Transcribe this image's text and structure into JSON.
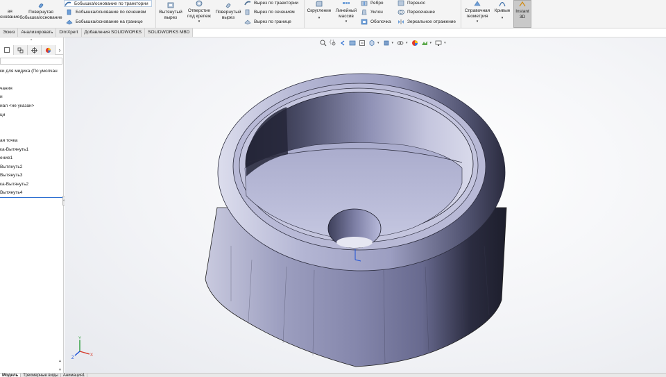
{
  "ribbon": {
    "revolve_boss_label_partial": "ая\nснование",
    "revolve_boss_label": "Повернутая\nбобышка/основание",
    "swept_boss_label": "Бобышка/основание по траектории",
    "lofted_boss_label": "Бобышка/основание по сечениям",
    "boundary_boss_label": "Бобышка/основание на границе",
    "extruded_cut_label": "Вытянутый\nвырез",
    "hole_wizard_label": "Отверстие\nпод крепеж",
    "revolved_cut_label": "Повернутый\nвырез",
    "swept_cut_label": "Вырез по траектории",
    "lofted_cut_label": "Вырез по сечениям",
    "boundary_cut_label": "Вырез по границе",
    "fillet_label": "Скругление",
    "linear_pattern_label": "Линейный\nмассив",
    "rib_label": "Ребро",
    "draft_label": "Уклон",
    "shell_label": "Оболочка",
    "wrap_label": "Перенос",
    "intersect_label": "Пересечение",
    "mirror_label": "Зеркальное отражение",
    "ref_geometry_label": "Справочная\nгеометрия",
    "curves_label": "Кривые",
    "instant3d_label": "Instant\n3D"
  },
  "tabs": [
    "Эскиз",
    "Анализировать",
    "DimXpert",
    "Добавления SOLIDWORKS",
    "SOLIDWORKS MBD"
  ],
  "feature_tree": {
    "part_label": "ки для мидика  (По умолчан",
    "items": [
      "чания",
      "и",
      "иал <не указан>",
      "ци",
      "",
      "",
      "ая точка",
      "ка-Вытянуть1",
      "ение1",
      "Вытянуть2",
      "Вытянуть3",
      "ка-Вытянуть2",
      "Вытянуть4"
    ]
  },
  "bottom_tabs": [
    "Модель",
    "Трехмерные виды",
    "Анимация1"
  ],
  "colors": {
    "accent": "#2c6fd1",
    "part_body": "#a6a8c9",
    "viewport_bg": "#f3f4f7"
  },
  "triad": {
    "x": "X",
    "y": "Y",
    "z": "Z"
  }
}
